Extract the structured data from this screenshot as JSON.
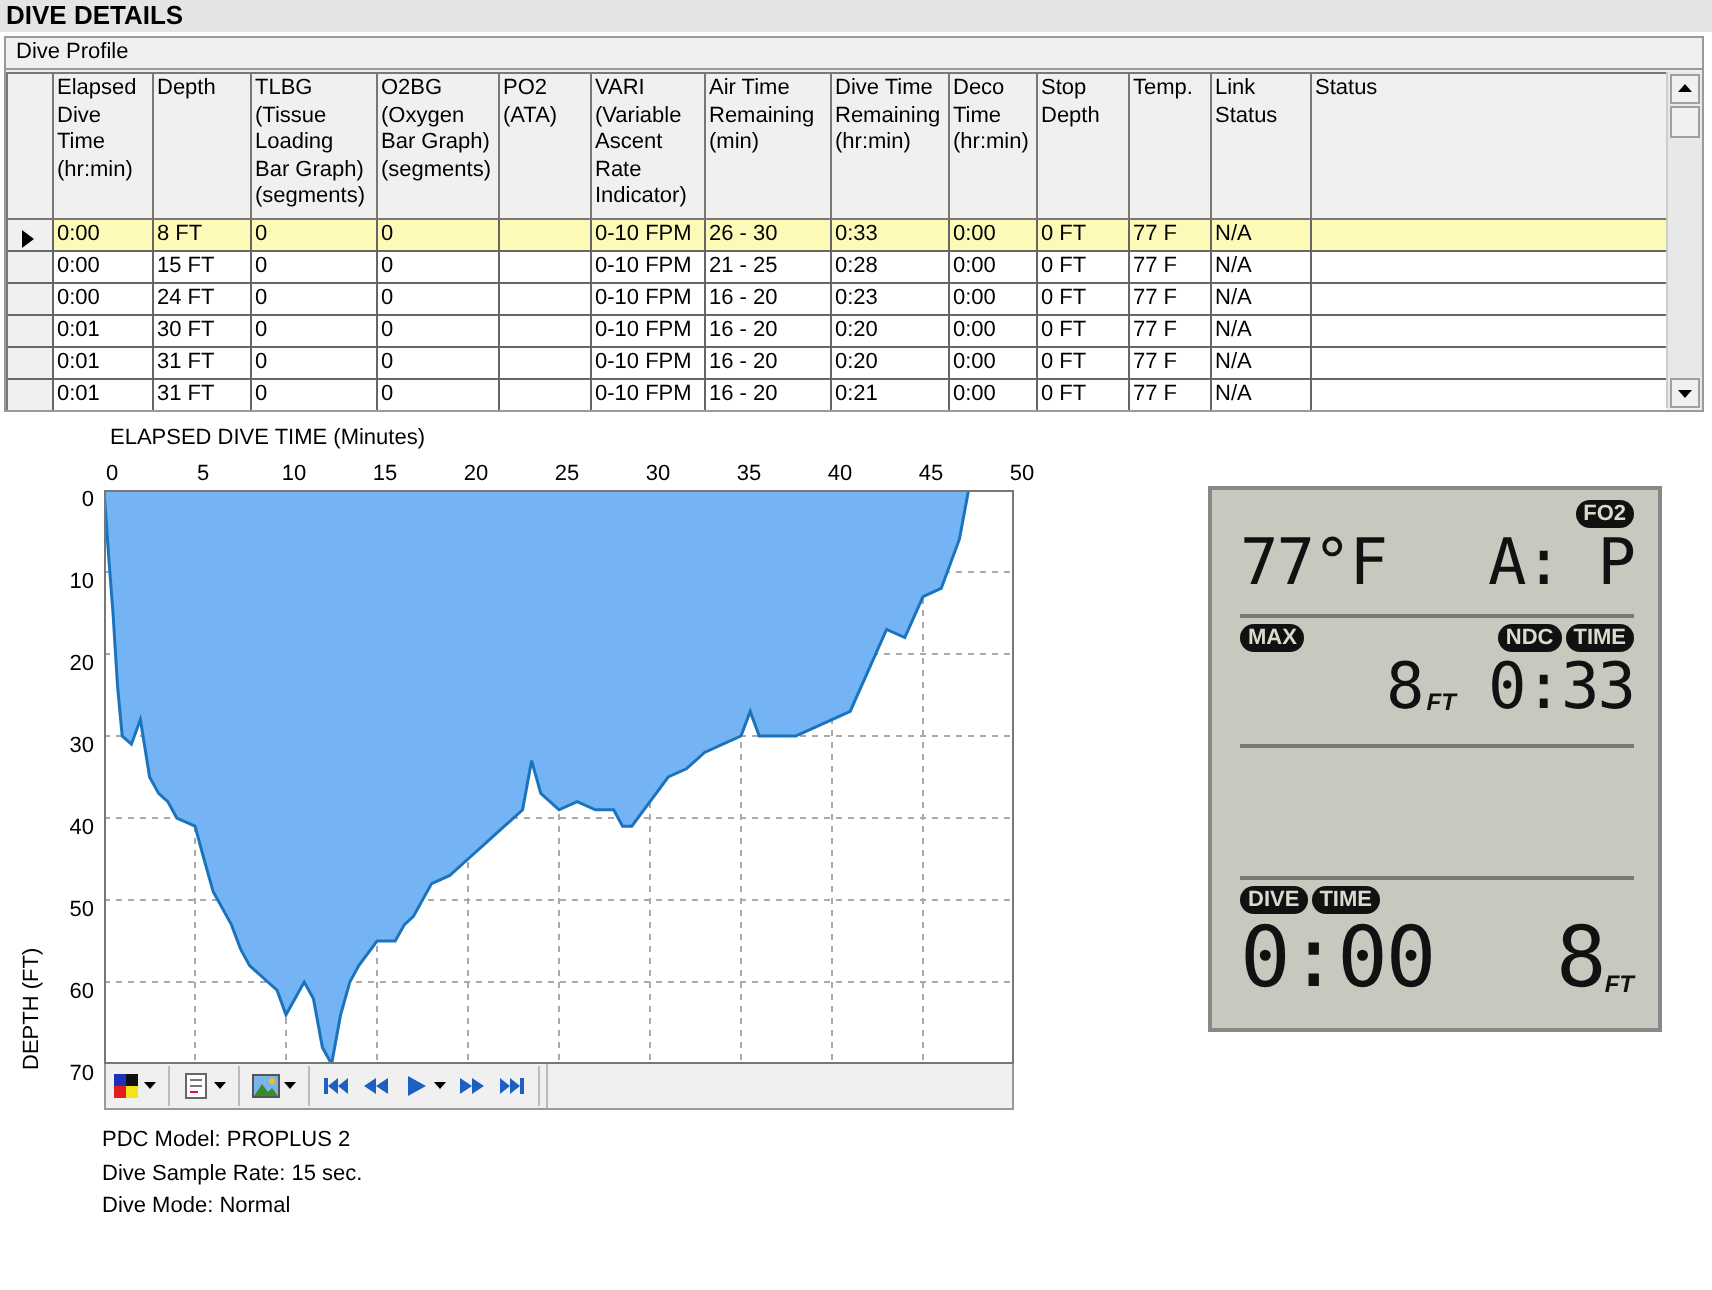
{
  "header": {
    "title": "DIVE DETAILS"
  },
  "table": {
    "caption": "Dive Profile",
    "columns": [
      "Elapsed Dive Time (hr:min)",
      "Depth",
      "TLBG (Tissue Loading Bar Graph) (segments)",
      "O2BG (Oxygen Bar Graph) (segments)",
      "PO2 (ATA)",
      "VARI (Variable Ascent Rate Indicator)",
      "Air Time Remaining (min)",
      "Dive Time Remaining (hr:min)",
      "Deco Time (hr:min)",
      "Stop Depth",
      "Temp.",
      "Link Status",
      "Status"
    ],
    "rows": [
      {
        "selected": true,
        "cells": [
          "0:00",
          "8 FT",
          "0",
          "0",
          "",
          "0-10 FPM",
          "26 - 30",
          "0:33",
          "0:00",
          "0 FT",
          "77 F",
          "N/A",
          ""
        ]
      },
      {
        "selected": false,
        "cells": [
          "0:00",
          "15 FT",
          "0",
          "0",
          "",
          "0-10 FPM",
          "21 - 25",
          "0:28",
          "0:00",
          "0 FT",
          "77 F",
          "N/A",
          ""
        ]
      },
      {
        "selected": false,
        "cells": [
          "0:00",
          "24 FT",
          "0",
          "0",
          "",
          "0-10 FPM",
          "16 - 20",
          "0:23",
          "0:00",
          "0 FT",
          "77 F",
          "N/A",
          ""
        ]
      },
      {
        "selected": false,
        "cells": [
          "0:01",
          "30 FT",
          "0",
          "0",
          "",
          "0-10 FPM",
          "16 - 20",
          "0:20",
          "0:00",
          "0 FT",
          "77 F",
          "N/A",
          ""
        ]
      },
      {
        "selected": false,
        "cells": [
          "0:01",
          "31 FT",
          "0",
          "0",
          "",
          "0-10 FPM",
          "16 - 20",
          "0:20",
          "0:00",
          "0 FT",
          "77 F",
          "N/A",
          ""
        ]
      },
      {
        "selected": false,
        "cells": [
          "0:01",
          "31 FT",
          "0",
          "0",
          "",
          "0-10 FPM",
          "16 - 20",
          "0:21",
          "0:00",
          "0 FT",
          "77 F",
          "N/A",
          ""
        ]
      }
    ]
  },
  "chart": {
    "chart_data": {
      "type": "area",
      "xlabel": "ELAPSED DIVE TIME (Minutes)",
      "ylabel": "DEPTH (FT)",
      "x": [
        0,
        0.25,
        0.5,
        0.75,
        1,
        1.5,
        2,
        2.5,
        3,
        3.5,
        4,
        5,
        5.5,
        6,
        7,
        7.5,
        8,
        9,
        9.5,
        10,
        11,
        11.5,
        12,
        12.5,
        13,
        13.5,
        14,
        15,
        16,
        16.5,
        17,
        18,
        19,
        20,
        21,
        22,
        23,
        23.5,
        24,
        25,
        26,
        27,
        28,
        28.5,
        29,
        30,
        31,
        32,
        33,
        34,
        35,
        35.5,
        36,
        37,
        38,
        39,
        40,
        41,
        42,
        43,
        44,
        45,
        46,
        47,
        47.5
      ],
      "grid": true,
      "series": [
        {
          "color": "#74b4f4",
          "values": [
            0,
            8,
            15,
            24,
            30,
            31,
            28,
            35,
            37,
            38,
            40,
            41,
            45,
            49,
            53,
            56,
            58,
            60,
            61,
            64,
            60,
            62,
            68,
            70,
            64,
            60,
            58,
            55,
            55,
            53,
            52,
            48,
            47,
            45,
            43,
            41,
            39,
            33,
            37,
            39,
            38,
            39,
            39,
            41,
            41,
            38,
            35,
            34,
            32,
            31,
            30,
            27,
            30,
            30,
            30,
            29,
            28,
            27,
            22,
            17,
            18,
            13,
            12,
            6,
            0
          ]
        }
      ],
      "xlim": [
        0,
        50
      ],
      "ylim": [
        70,
        0
      ],
      "xticks": [
        0,
        5,
        10,
        15,
        20,
        25,
        30,
        35,
        40,
        45,
        50
      ],
      "yticks": [
        0,
        10,
        20,
        30,
        40,
        50,
        60,
        70
      ]
    }
  },
  "toolbar": {
    "buttons": [
      {
        "kind": "palette",
        "dropdown": true
      },
      {
        "kind": "report",
        "dropdown": true
      },
      {
        "kind": "image",
        "dropdown": true
      },
      {
        "kind": "first",
        "dropdown": false
      },
      {
        "kind": "rewind",
        "dropdown": false
      },
      {
        "kind": "play",
        "dropdown": true
      },
      {
        "kind": "forward",
        "dropdown": false
      },
      {
        "kind": "last",
        "dropdown": false
      }
    ]
  },
  "info": [
    "PDC Model: PROPLUS 2",
    "Dive Sample Rate: 15 sec.",
    "Dive Mode: Normal"
  ],
  "display": {
    "fo2_badge": "FO2",
    "temperature": "77°F",
    "fo2_value": "A: P",
    "max_badge": "MAX",
    "ndc_badge": "NDC",
    "ndc_time_badge": "TIME",
    "max_depth": "8",
    "max_depth_unit": "FT",
    "ndc_time": "0:33",
    "dive_badge": "DIVE",
    "dive_time_badge": "TIME",
    "dive_time": "0:00",
    "depth": "8",
    "depth_unit": "FT"
  }
}
